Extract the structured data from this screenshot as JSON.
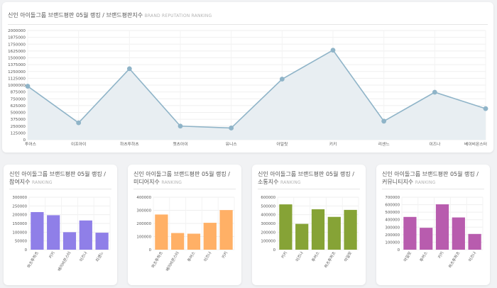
{
  "main": {
    "title": "신인 아이돌그룹 브랜드평판 05월 랭킹 / 브랜드평판지수",
    "subtitle": "BRAND REPUTATION RANKING"
  },
  "small_cards": [
    {
      "title": "신인 아이돌그룹 브랜드평판 05월 랭킹 /",
      "title2": "참여지수",
      "subtitle": "RANKING"
    },
    {
      "title": "신인 아이돌그룹 브랜드평판 05월 랭킹 /",
      "title2": "미디어지수",
      "subtitle": "RANKING"
    },
    {
      "title": "신인 아이돌그룹 브랜드평판 05월 랭킹 /",
      "title2": "소통지수",
      "subtitle": "RANKING"
    },
    {
      "title": "신인 아이돌그룹 브랜드평판 05월 랭킹 /",
      "title2": "커뮤니티지수",
      "subtitle": "RANKING"
    }
  ],
  "chart_data": [
    {
      "type": "area",
      "title": "신인 아이돌그룹 브랜드평판 05월 랭킹 / 브랜드평판지수",
      "categories": [
        "투어스",
        "이프아이",
        "하츠투하츠",
        "캣츠아이",
        "유니스",
        "아일릿",
        "키키",
        "리센느",
        "이즈나",
        "베이비몬스터"
      ],
      "values": [
        980000,
        310000,
        1300000,
        250000,
        215000,
        1110000,
        1640000,
        340000,
        870000,
        570000
      ],
      "ylim": [
        0,
        2000000
      ],
      "yticks": [
        "0",
        "125000",
        "250000",
        "375000",
        "500000",
        "625000",
        "750000",
        "875000",
        "1000000",
        "1125000",
        "1250000",
        "1375000",
        "1500000",
        "1625000",
        "1750000",
        "1875000",
        "2000000"
      ],
      "grid": true,
      "color": "#8fb4c8",
      "fill": "#e8eef2"
    },
    {
      "type": "bar",
      "categories": [
        "하츠투하츠",
        "키키",
        "베이비몬스터",
        "이즈나",
        "리센느"
      ],
      "values": [
        215000,
        197000,
        100000,
        167000,
        97000
      ],
      "ylim": [
        0,
        300000
      ],
      "yticks": [
        "0",
        "50000",
        "100000",
        "150000",
        "200000",
        "250000",
        "300000"
      ],
      "color": "#8f7fe8"
    },
    {
      "type": "bar",
      "categories": [
        "하츠투하츠",
        "베이비몬스터",
        "투어스",
        "이즈나",
        "키키"
      ],
      "values": [
        268000,
        127000,
        122000,
        205000,
        302000
      ],
      "ylim": [
        0,
        400000
      ],
      "yticks": [
        "0",
        "100000",
        "200000",
        "300000",
        "400000"
      ],
      "color": "#ffb066"
    },
    {
      "type": "bar",
      "categories": [
        "키키",
        "이즈나",
        "투어스",
        "하츠투하츠",
        "아일릿"
      ],
      "values": [
        518000,
        295000,
        462000,
        375000,
        455000
      ],
      "ylim": [
        0,
        600000
      ],
      "yticks": [
        "0",
        "100000",
        "200000",
        "300000",
        "400000",
        "500000",
        "600000"
      ],
      "color": "#86a336"
    },
    {
      "type": "bar",
      "categories": [
        "아일릿",
        "투어스",
        "키키",
        "하츠투하츠",
        "이즈나"
      ],
      "values": [
        437000,
        292000,
        605000,
        430000,
        210000
      ],
      "ylim": [
        0,
        700000
      ],
      "yticks": [
        "0",
        "100000",
        "200000",
        "300000",
        "400000",
        "500000",
        "600000",
        "700000"
      ],
      "color": "#b85cae"
    }
  ]
}
